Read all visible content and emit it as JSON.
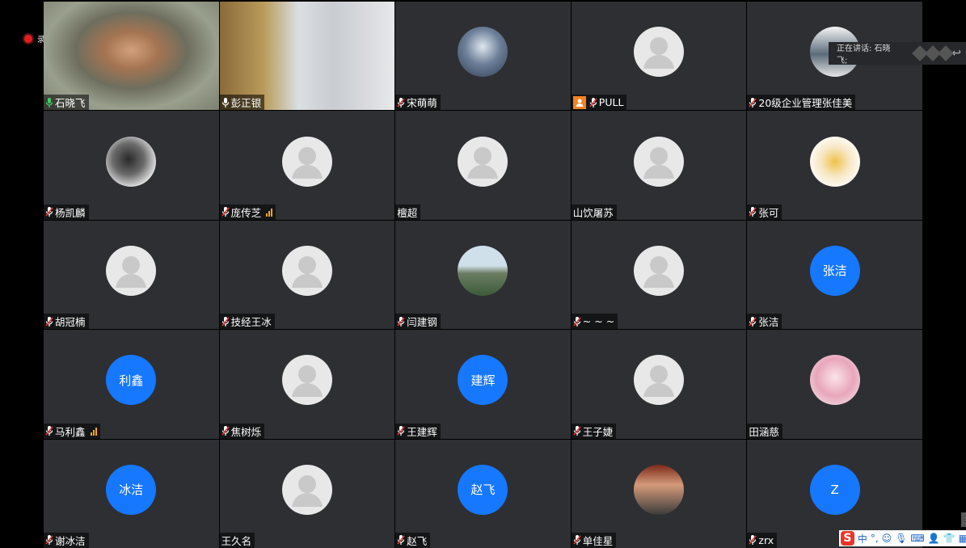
{
  "recording": {
    "label": "录制中"
  },
  "speaker": {
    "label": "正在讲话: 石晓飞;"
  },
  "ime": {
    "logo": "S",
    "mode": "中",
    "punct": "°,"
  },
  "participants": [
    {
      "name": "石晓飞",
      "type": "video",
      "mic": "green",
      "active": true,
      "video": "man1"
    },
    {
      "name": "彭正银",
      "type": "video",
      "mic": "white",
      "video": "man2"
    },
    {
      "name": "宋萌萌",
      "type": "photo",
      "mic": "muted",
      "photo": "girl"
    },
    {
      "name": "PULL",
      "type": "default",
      "mic": "muted",
      "host": true
    },
    {
      "name": "20级企业管理张佳美",
      "type": "photo",
      "mic": "muted",
      "photo": "figure"
    },
    {
      "name": "杨凯麟",
      "type": "photo",
      "mic": "muted",
      "photo": "ink"
    },
    {
      "name": "庞传芝",
      "type": "default",
      "mic": "muted",
      "signal": true
    },
    {
      "name": "檀超",
      "type": "default",
      "mic": "none"
    },
    {
      "name": "山饮屠苏",
      "type": "default",
      "mic": "none"
    },
    {
      "name": "张可",
      "type": "photo",
      "mic": "muted",
      "photo": "flowers"
    },
    {
      "name": "胡冠楠",
      "type": "default",
      "mic": "muted"
    },
    {
      "name": "技经王冰",
      "type": "default",
      "mic": "muted"
    },
    {
      "name": "闫建钢",
      "type": "photo",
      "mic": "muted",
      "photo": "bridge"
    },
    {
      "name": "~ ~ ~",
      "type": "default",
      "mic": "muted"
    },
    {
      "name": "张洁",
      "type": "initial",
      "initial": "张洁",
      "mic": "muted"
    },
    {
      "name": "马利鑫",
      "type": "initial",
      "initial": "利鑫",
      "mic": "muted",
      "signal": true
    },
    {
      "name": "焦树烁",
      "type": "default",
      "mic": "muted"
    },
    {
      "name": "王建辉",
      "type": "initial",
      "initial": "建辉",
      "mic": "muted"
    },
    {
      "name": "王子婕",
      "type": "default",
      "mic": "muted"
    },
    {
      "name": "田涵慈",
      "type": "photo",
      "mic": "none",
      "photo": "anime"
    },
    {
      "name": "谢冰洁",
      "type": "initial",
      "initial": "冰洁",
      "mic": "muted"
    },
    {
      "name": "王久名",
      "type": "default",
      "mic": "none"
    },
    {
      "name": "赵飞",
      "type": "initial",
      "initial": "赵飞",
      "mic": "muted"
    },
    {
      "name": "单佳星",
      "type": "photo",
      "mic": "muted",
      "photo": "lady"
    },
    {
      "name": "zrx",
      "type": "initial",
      "initial": "Z",
      "mic": "muted"
    }
  ],
  "colors": {
    "tile": "#2d2f33",
    "accent_blue": "#1677ff",
    "active_border": "#3aa55c",
    "host_badge": "#f5821f",
    "signal": "#f5a623"
  }
}
